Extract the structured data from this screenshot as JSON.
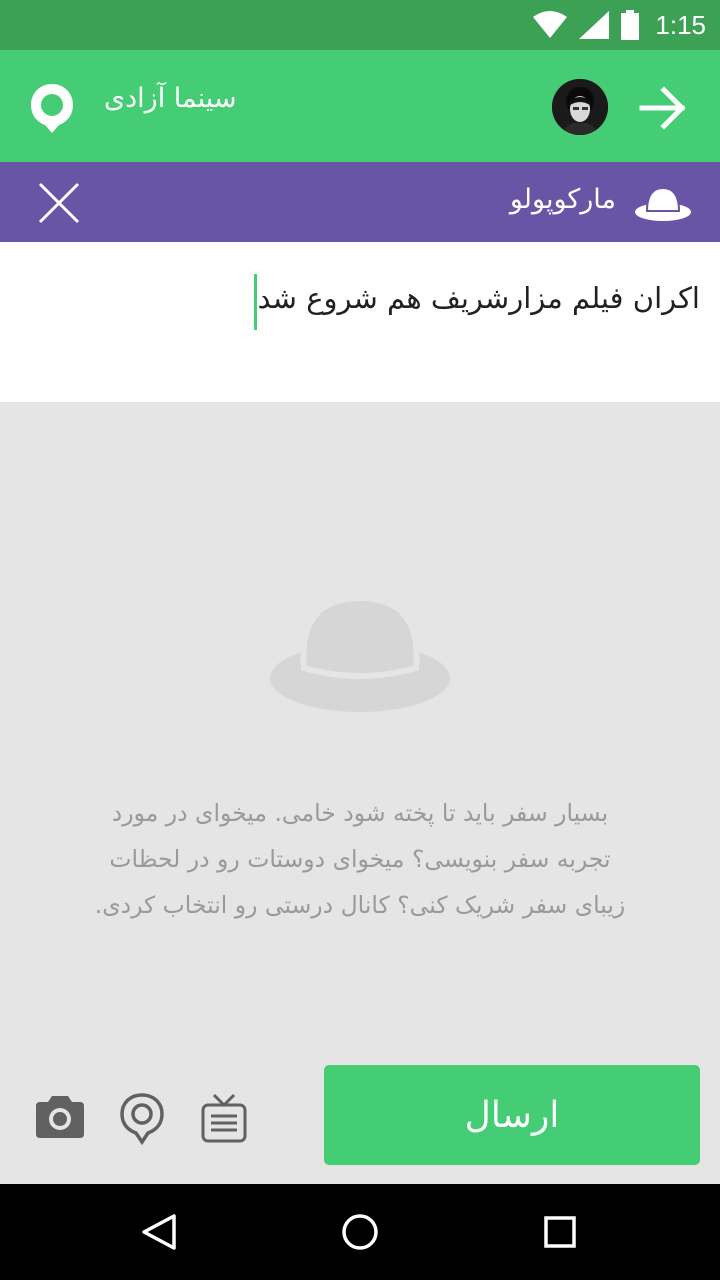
{
  "status_bar": {
    "time": "1:15",
    "icons": [
      "wifi-icon",
      "signal-icon",
      "battery-icon"
    ]
  },
  "app_bar": {
    "title": "سینما آزادی",
    "logo_icon": "location-bubble-icon",
    "forward_icon": "arrow-forward-icon"
  },
  "channel_bar": {
    "name": "مارکوپولو",
    "channel_icon": "hat-icon",
    "close_icon": "close-icon"
  },
  "compose": {
    "value": "اکران فیلم مزارشریف هم شروع شد"
  },
  "empty_state": {
    "icon": "hat-icon",
    "lines": [
      "بسیار سفر باید تا پخته شود خامی. میخوای در مورد",
      "تجربه سفر بنویسی؟ میخوای دوستات رو در لحظات",
      "زیبای سفر شریک کنی؟ کانال درستی رو انتخاب کردی."
    ]
  },
  "toolbar": {
    "send_label": "ارسال",
    "tools": [
      "camera-icon",
      "place-icon",
      "tv-icon"
    ]
  },
  "nav": {
    "icons": [
      "back-icon",
      "home-icon",
      "recents-icon"
    ]
  },
  "colors": {
    "status": "#3ca055",
    "primary": "#44cd74",
    "channel": "#6a54a6",
    "background": "#e5e5e5",
    "muted_text": "#9a9a9a"
  }
}
